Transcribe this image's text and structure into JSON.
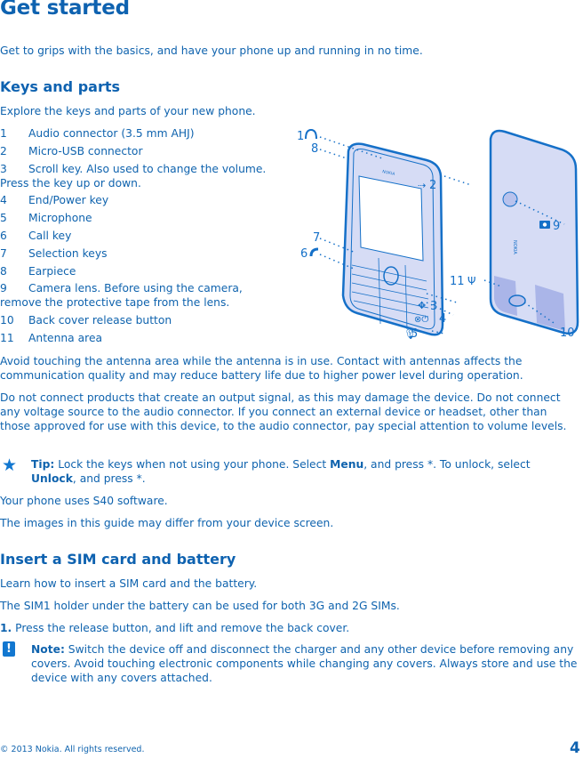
{
  "title": "Get started",
  "intro": "Get to grips with the basics, and have your phone up and running in no time.",
  "keys_section": {
    "heading": "Keys and parts",
    "intro": "Explore the keys and parts of your new phone.",
    "parts": [
      {
        "num": "1",
        "label": "Audio connector (3.5 mm AHJ)"
      },
      {
        "num": "2",
        "label": "Micro-USB connector"
      },
      {
        "num": "3",
        "label": "Scroll key. Also used to change the volume.",
        "cont": "Press the key up or down."
      },
      {
        "num": "4",
        "label": "End/Power key"
      },
      {
        "num": "5",
        "label": "Microphone"
      },
      {
        "num": "6",
        "label": "Call key"
      },
      {
        "num": "7",
        "label": "Selection keys"
      },
      {
        "num": "8",
        "label": "Earpiece"
      },
      {
        "num": "9",
        "label": "Camera lens. Before using the camera,",
        "cont": "remove the protective tape from the lens."
      },
      {
        "num": "10",
        "label": "Back cover release button"
      },
      {
        "num": "11",
        "label": "Antenna area"
      }
    ],
    "callouts": {
      "c1": "1",
      "c2": "2",
      "c3": "3",
      "c4": "4",
      "c5": "5",
      "c6": "6",
      "c7": "7",
      "c8": "8",
      "c9": "9",
      "c10": "10",
      "c11": "11"
    },
    "phone_brand": "NOKIA",
    "antenna_warning": "Avoid touching the antenna area while the antenna is in use. Contact with antennas affects the communication quality and may reduce battery life due to higher power level during operation.",
    "connect_warning": "Do not connect products that create an output signal, as this may damage the device. Do not connect any voltage source to the audio connector. If you connect an external device or headset, other than those approved for use with this device, to the audio connector, pay special attention to volume levels.",
    "tip": {
      "icon": "star-icon",
      "label": "Tip:",
      "text1": " Lock the keys when not using your phone. Select ",
      "bold1": "Menu",
      "text2": ", and press *. To unlock, select ",
      "bold2": "Unlock",
      "text3": ", and press *."
    },
    "software": "Your phone uses S40 software.",
    "images_note": "The images in this guide may differ from your device screen."
  },
  "sim_section": {
    "heading": "Insert a SIM card and battery",
    "intro": "Learn how to insert a SIM card and the battery.",
    "sim_holder": "The SIM1 holder under the battery can be used for both 3G and 2G SIMs.",
    "step1_num": "1.",
    "step1_text": " Press the release button, and lift and remove the back cover.",
    "note": {
      "icon": "exclamation-icon",
      "icon_glyph": "!",
      "label": "Note:",
      "text": " Switch the device off and disconnect the charger and any other device before removing any covers. Avoid touching electronic components while changing any covers. Always store and use the device with any covers attached."
    }
  },
  "footer": {
    "copyright": "© 2013 Nokia. All rights reserved.",
    "page_number": "4"
  },
  "colors": {
    "text": "#0f63ae",
    "heading": "#0e62b0",
    "phone_fill": "#d6dcf5",
    "phone_stroke": "#1570c8",
    "icon_fill": "#1277d0"
  }
}
